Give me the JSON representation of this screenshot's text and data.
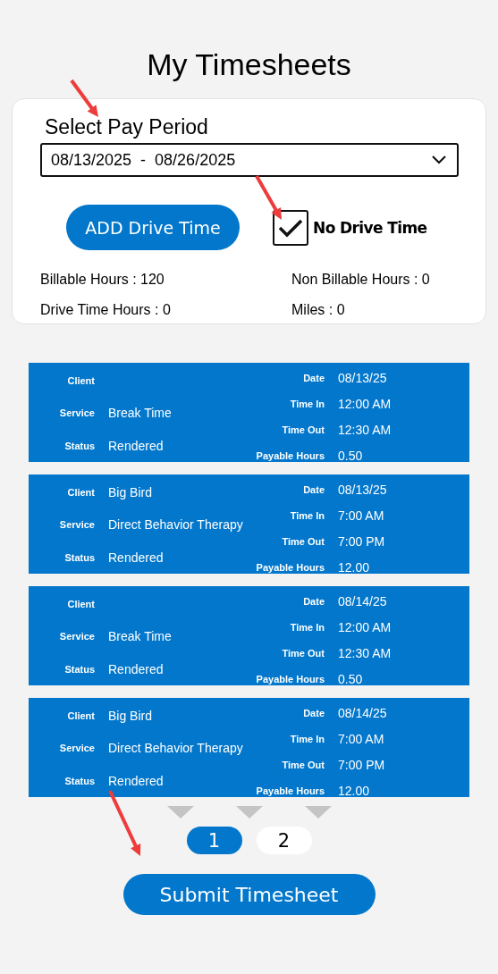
{
  "title": "My Timesheets",
  "pay_period": {
    "label": "Select Pay Period",
    "value": "08/13/2025  -  08/26/2025"
  },
  "add_drive_time_button": "ADD Drive Time",
  "no_drive_time": {
    "label": "No Drive Time",
    "checked": true
  },
  "stats": [
    {
      "label": "Billable Hours : 120"
    },
    {
      "label": "Non Billable Hours : 0"
    },
    {
      "label": "Drive Time Hours : 0"
    },
    {
      "label": "Miles : 0"
    }
  ],
  "entries": [
    {
      "client_label": "Client",
      "service_label": "Service",
      "service": "Break Time",
      "status_label": "Status",
      "status": "Rendered",
      "date_label": "Date",
      "date": "08/13/25",
      "time_in_label": "Time In",
      "time_in": "12:00 AM",
      "time_out_label": "Time Out",
      "time_out": "12:30 AM",
      "hours_label": "Payable Hours",
      "hours": "0.50"
    },
    {
      "client_label": "Client",
      "client": "Big Bird",
      "service_label": "Service",
      "service": "Direct Behavior Therapy",
      "status_label": "Status",
      "status": "Rendered",
      "date_label": "Date",
      "date": "08/13/25",
      "time_in_label": "Time In",
      "time_in": "7:00 AM",
      "time_out_label": "Time Out",
      "time_out": "7:00 PM",
      "hours_label": "Payable Hours",
      "hours": "12.00"
    },
    {
      "client_label": "Client",
      "service_label": "Service",
      "service": "Break Time",
      "status_label": "Status",
      "status": "Rendered",
      "date_label": "Date",
      "date": "08/14/25",
      "time_in_label": "Time In",
      "time_in": "12:00 AM",
      "time_out_label": "Time Out",
      "time_out": "12:30 AM",
      "hours_label": "Payable Hours",
      "hours": "0.50"
    },
    {
      "client_label": "Client",
      "client": "Big Bird",
      "service_label": "Service",
      "service": "Direct Behavior Therapy",
      "status_label": "Status",
      "status": "Rendered",
      "date_label": "Date",
      "date": "08/14/25",
      "time_in_label": "Time In",
      "time_in": "7:00 AM",
      "time_out_label": "Time Out",
      "time_out": "7:00 PM",
      "hours_label": "Payable Hours",
      "hours": "12.00"
    }
  ],
  "pages": [
    {
      "label": "1",
      "selected": true
    },
    {
      "label": "2",
      "selected": false
    }
  ],
  "submit_button": "Submit Timesheet"
}
